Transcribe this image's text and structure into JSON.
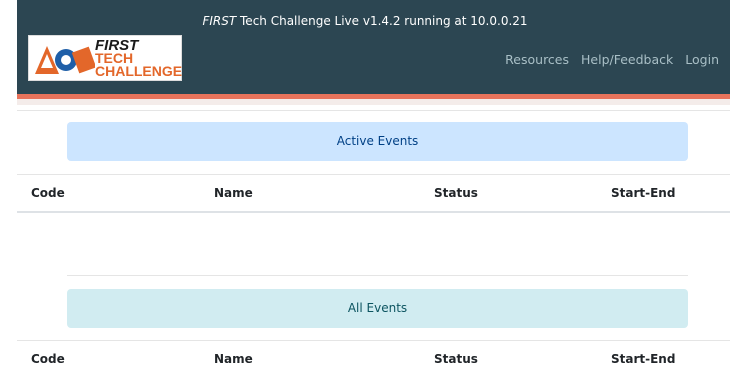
{
  "header": {
    "version_prefix": "FIRST",
    "version_text": " Tech Challenge Live v1.4.2 running at 10.0.0.21",
    "logo": {
      "line1": "FIRST",
      "line2": "TECH",
      "line3": "CHALLENGE",
      "icon": "ftc-logo-icon"
    },
    "nav": [
      "Resources",
      "Help/Feedback",
      "Login"
    ]
  },
  "active_events": {
    "title": "Active Events",
    "columns": [
      "Code",
      "Name",
      "Status",
      "Start-End"
    ]
  },
  "all_events": {
    "title": "All Events",
    "columns": [
      "Code",
      "Name",
      "Status",
      "Start-End"
    ]
  },
  "colors": {
    "header_bg": "#2c4652",
    "accent_strip": "#e8735b",
    "active_banner_bg": "#cce5ff",
    "all_banner_bg": "#d1ecf1"
  }
}
